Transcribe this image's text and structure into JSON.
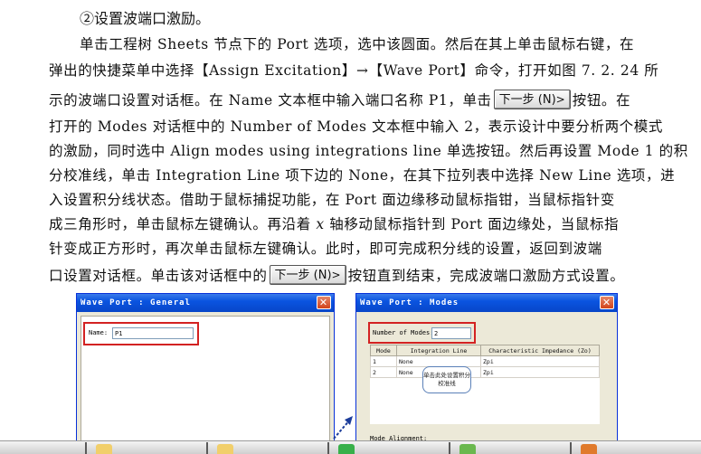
{
  "heading": "②设置波端口激励。",
  "paragraph": {
    "l1": "单击工程树 Sheets 节点下的 Port 选项，选中该圆面。然后在其上单击鼠标右键，在",
    "l2": "弹出的快捷菜单中选择【Assign Excitation】→【Wave Port】命令，打开如图 7. 2. 24 所",
    "l3a": "示的波端口设置对话框。在 Name 文本框中输入端口名称 P1，单击",
    "l3b": "按钮。在",
    "l4": "打开的 Modes 对话框中的 Number of Modes 文本框中输入 2，表示设计中要分析两个模式",
    "l5": "的激励，同时选中 Align modes using integrations line 单选按钮。然后再设置 Mode 1 的积",
    "l6": "分校准线，单击 Integration Line 项下边的 None，在其下拉列表中选择 New Line 选项，进",
    "l7": "入设置积分线状态。借助于鼠标捕捉功能，在 Port 面边缘移动鼠标指钳，当鼠标指针变",
    "l8a": "成三角形时，单击鼠标左键确认。再沿着 ",
    "l8x": "x",
    "l8b": " 轴移动鼠标指针到 Port 面边缘处，当鼠标指",
    "l9": "针变成正方形时，再次单击鼠标左键确认。此时，即可完成积分线的设置，返回到波端",
    "l10a": "口设置对话框。单击该对话框中的",
    "l10b": "按钮直到结束，完成波端口激励方式设置。",
    "next_btn": "下一步 (N)",
    "next_btn_arrow": ">"
  },
  "dialog_general": {
    "title": "Wave Port : General",
    "name_label": "Name:",
    "name_value": "P1"
  },
  "dialog_modes": {
    "title": "Wave Port : Modes",
    "num_modes_label": "Number of Modes:",
    "num_modes_value": "2",
    "columns": [
      "Mode",
      "Integration Line",
      "Characteristic Impedance (Zo)"
    ],
    "rows": [
      {
        "mode": "1",
        "line": "None",
        "imp": "Zpi"
      },
      {
        "mode": "2",
        "line": "None",
        "imp": "Zpi"
      }
    ],
    "callout": "单击此处设置积分校准线",
    "mode_alignment": "Mode Alignment:"
  },
  "close_glyph": "✕"
}
